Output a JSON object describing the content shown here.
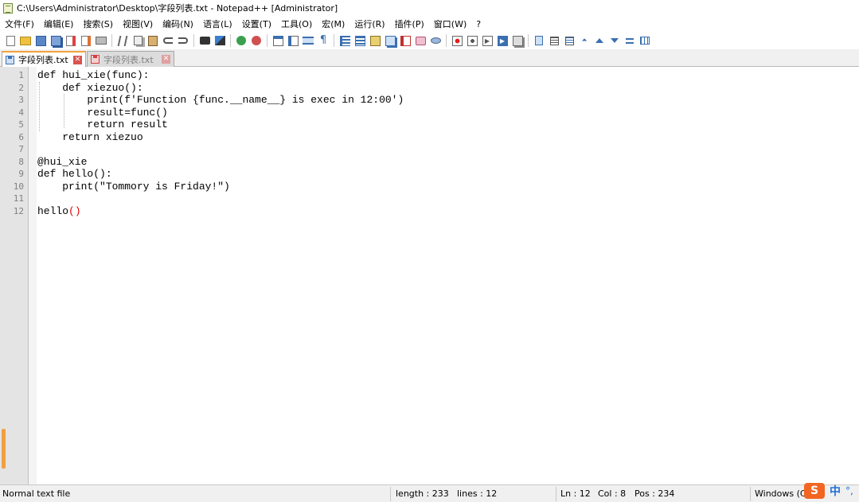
{
  "window": {
    "title": "C:\\Users\\Administrator\\Desktop\\字段列表.txt - Notepad++ [Administrator]"
  },
  "menu": [
    "文件(F)",
    "编辑(E)",
    "搜索(S)",
    "视图(V)",
    "编码(N)",
    "语言(L)",
    "设置(T)",
    "工具(O)",
    "宏(M)",
    "运行(R)",
    "插件(P)",
    "窗口(W)",
    "?"
  ],
  "toolbar": {
    "icons": [
      "new-file-icon",
      "open-file-icon",
      "save-icon",
      "save-all-icon",
      "close-icon",
      "close-all-icon",
      "print-icon",
      "cut-icon",
      "copy-icon",
      "paste-icon",
      "undo-icon",
      "redo-icon",
      "find-icon",
      "replace-icon",
      "zoom-in-icon",
      "zoom-out-icon",
      "sync-vertical-icon",
      "sync-horizontal-icon",
      "word-wrap-icon",
      "show-all-chars-icon",
      "indent-guide-icon",
      "lang-define-icon",
      "doc-map-icon",
      "function-list-icon",
      "folder-workspace-icon",
      "monitor-icon",
      "record-macro-icon",
      "stop-record-icon",
      "play-macro-icon",
      "run-macro-multiple-icon",
      "save-macro-icon",
      "bookmark-icon",
      "clipboard-history-icon",
      "document-switch-icon",
      "arrow-up-icon",
      "arrow-down-icon",
      "collapse-icon",
      "panel-icon"
    ]
  },
  "tabs": [
    {
      "label": "字段列表.txt",
      "active": true
    },
    {
      "label": "字段列表.txt",
      "active": false
    }
  ],
  "editor": {
    "lines": [
      {
        "num": "1",
        "text": "def hui_xie(func):"
      },
      {
        "num": "2",
        "text": "    def xiezuo():"
      },
      {
        "num": "3",
        "text": "        print(f'Function {func.__name__} is exec in 12:00')"
      },
      {
        "num": "4",
        "text": "        result=func()"
      },
      {
        "num": "5",
        "text": "        return result"
      },
      {
        "num": "6",
        "text": "    return xiezuo"
      },
      {
        "num": "7",
        "text": ""
      },
      {
        "num": "8",
        "text": "@hui_xie"
      },
      {
        "num": "9",
        "text": "def hello():"
      },
      {
        "num": "10",
        "text": "    print(\"Tommory is Friday!\")"
      },
      {
        "num": "11",
        "text": ""
      },
      {
        "num": "12",
        "text": "hello"
      }
    ],
    "line12_parens": "()"
  },
  "status": {
    "file_type": "Normal text file",
    "length": "length : 233",
    "lines": "lines : 12",
    "ln": "Ln : 12",
    "col": "Col : 8",
    "pos": "Pos : 234",
    "eol": "Windows (C",
    "ime_logo": "S",
    "ime_lang": "中",
    "ime_punct": "°,"
  },
  "colors": {
    "tab_active_accent": "#f2a23b",
    "close_button": "#d9534f",
    "brace_highlight": "#e00000",
    "gutter_bg": "#e4e4e4"
  }
}
